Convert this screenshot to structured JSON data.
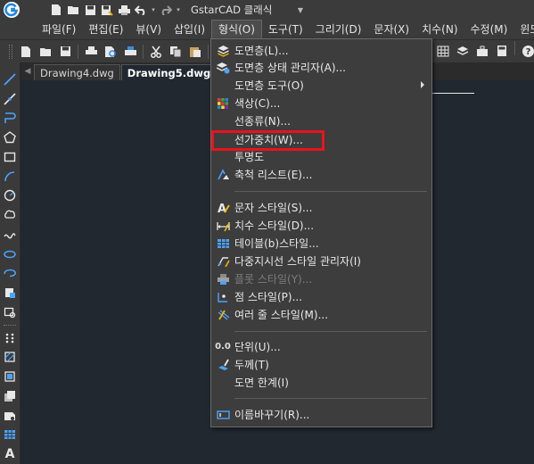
{
  "app": {
    "name": "GstarCAD 클래식",
    "colors": {
      "accent": "#1e88e5",
      "highlight": "#e8141b"
    }
  },
  "quick_access": [
    "new-file-icon",
    "open-folder-icon",
    "save-icon",
    "save-as-icon",
    "print-icon",
    "undo-icon",
    "redo-icon"
  ],
  "menubar": {
    "items": [
      {
        "label": "파일(F)"
      },
      {
        "label": "편집(E)"
      },
      {
        "label": "뷰(V)"
      },
      {
        "label": "삽입(I)"
      },
      {
        "label": "형식(O)",
        "active": true
      },
      {
        "label": "도구(T)"
      },
      {
        "label": "그리기(D)"
      },
      {
        "label": "문자(X)"
      },
      {
        "label": "치수(N)"
      },
      {
        "label": "수정(M)"
      },
      {
        "label": "윈도우"
      }
    ]
  },
  "doc_tabs": [
    {
      "label": "Drawing4.dwg",
      "active": false
    },
    {
      "label": "Drawing5.dwg",
      "active": true
    }
  ],
  "format_menu": {
    "items": [
      {
        "label": "도면층(L)...",
        "icon": "layer-icon"
      },
      {
        "label": "도면층 상태 관리자(A)...",
        "icon": "layer-state-icon"
      },
      {
        "label": "도면층 도구(O)",
        "icon": "",
        "submenu": true
      },
      {
        "label": "색상(C)...",
        "icon": "color-grid-icon"
      },
      {
        "label": "선종류(N)...",
        "icon": ""
      },
      {
        "label": "선가중치(W)...",
        "icon": "",
        "highlighted": true
      },
      {
        "label": "투명도",
        "icon": ""
      },
      {
        "label": "축척 리스트(E)...",
        "icon": "scale-list-icon"
      },
      {
        "label": "문자 스타일(S)...",
        "icon": "text-style-icon"
      },
      {
        "label": "치수 스타일(D)...",
        "icon": "dim-style-icon"
      },
      {
        "label": "테이블(b)스타일...",
        "icon": "table-style-icon"
      },
      {
        "label": "다중지시선 스타일 관리자(I)",
        "icon": "mleader-style-icon"
      },
      {
        "label": "플롯 스타일(Y)...",
        "icon": "plot-style-icon",
        "disabled": true
      },
      {
        "label": "점 스타일(P)...",
        "icon": "point-style-icon"
      },
      {
        "label": "여러 줄 스타일(M)...",
        "icon": "mline-style-icon"
      },
      {
        "label": "단위(U)...",
        "icon": "units-icon",
        "glyph": "0.0"
      },
      {
        "label": "두께(T)",
        "icon": "thickness-icon"
      },
      {
        "label": "도면 한계(I)",
        "icon": ""
      },
      {
        "label": "이름바꾸기(R)...",
        "icon": "rename-icon"
      }
    ]
  }
}
